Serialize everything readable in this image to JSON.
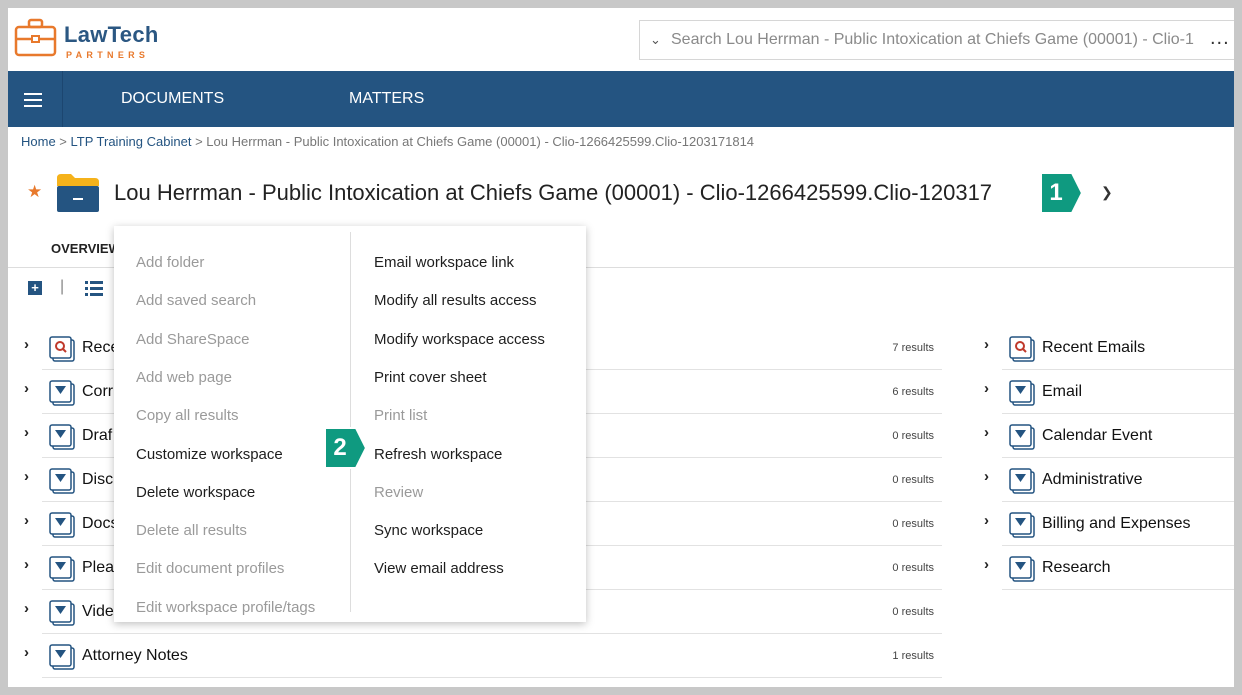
{
  "logo": {
    "line1": "LawTech",
    "line2": "PARTNERS"
  },
  "search": {
    "text": "Search Lou Herrman - Public Intoxication at Chiefs Game (00001) - Clio-1",
    "more": "..."
  },
  "nav": {
    "documents": "DOCUMENTS",
    "matters": "MATTERS"
  },
  "breadcrumb": {
    "home": "Home",
    "sep1": " > ",
    "cabinet": "LTP Training Cabinet",
    "sep2": " > ",
    "current": "Lou Herrman - Public Intoxication at Chiefs Game (00001) - Clio-1266425599.Clio-1203171814"
  },
  "title": "Lou Herrman - Public Intoxication at Chiefs Game (00001) - Clio-1266425599.Clio-120317",
  "callouts": {
    "one": "1",
    "two": "2"
  },
  "tabs": {
    "overview": "OVERVIEW"
  },
  "left_list": [
    {
      "label": "Rece",
      "count": "7 results",
      "icon": "search-folder"
    },
    {
      "label": "Corr",
      "count": "6 results",
      "icon": "filter-folder"
    },
    {
      "label": "Draf",
      "count": "0 results",
      "icon": "filter-folder"
    },
    {
      "label": "Disc",
      "count": "0 results",
      "icon": "filter-folder"
    },
    {
      "label": "Docs",
      "count": "0 results",
      "icon": "filter-folder"
    },
    {
      "label": "Plea",
      "count": "0 results",
      "icon": "filter-folder"
    },
    {
      "label": "Vide",
      "count": "0 results",
      "icon": "filter-folder"
    },
    {
      "label": "Attorney Notes",
      "count": "1 results",
      "icon": "filter-folder"
    }
  ],
  "right_list": [
    {
      "label": "Recent Emails",
      "icon": "search-folder"
    },
    {
      "label": "Email",
      "icon": "filter-folder"
    },
    {
      "label": "Calendar Event",
      "icon": "filter-folder"
    },
    {
      "label": "Administrative",
      "icon": "filter-folder"
    },
    {
      "label": "Billing and Expenses",
      "icon": "filter-folder"
    },
    {
      "label": "Research",
      "icon": "filter-folder"
    }
  ],
  "menu": {
    "left": [
      {
        "label": "Add folder",
        "enabled": false
      },
      {
        "label": "Add saved search",
        "enabled": false
      },
      {
        "label": "Add ShareSpace",
        "enabled": false
      },
      {
        "label": "Add web page",
        "enabled": false
      },
      {
        "label": "Copy all results",
        "enabled": false
      },
      {
        "label": "Customize workspace",
        "enabled": true
      },
      {
        "label": "Delete workspace",
        "enabled": true
      },
      {
        "label": "Delete all results",
        "enabled": false
      },
      {
        "label": "Edit document profiles",
        "enabled": false
      },
      {
        "label": "Edit workspace profile/tags",
        "enabled": false
      }
    ],
    "right": [
      {
        "label": "Email workspace link",
        "enabled": true
      },
      {
        "label": "Modify all results access",
        "enabled": true
      },
      {
        "label": "Modify workspace access",
        "enabled": true
      },
      {
        "label": "Print cover sheet",
        "enabled": true
      },
      {
        "label": "Print list",
        "enabled": false
      },
      {
        "label": "Refresh workspace",
        "enabled": true
      },
      {
        "label": "Review",
        "enabled": false
      },
      {
        "label": "Sync workspace",
        "enabled": true
      },
      {
        "label": "View email address",
        "enabled": true
      }
    ]
  },
  "colors": {
    "nav": "#245481",
    "accent": "#e8792c",
    "callout": "#0f9a80"
  }
}
